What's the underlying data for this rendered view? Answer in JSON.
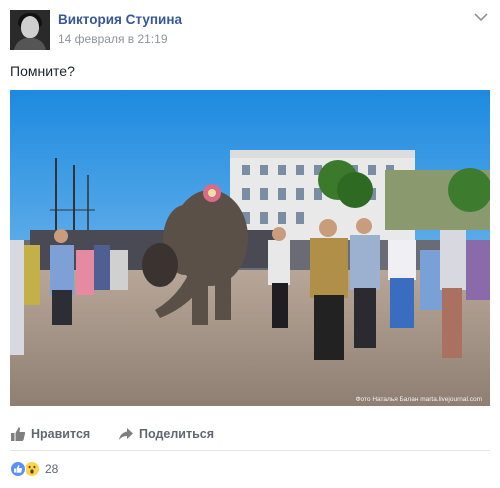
{
  "post": {
    "author": "Виктория Ступина",
    "timestamp": "14 февраля в 21:19",
    "text": "Помните?",
    "photo_credit": "Фото Наталья Балан marta.livejournal.com"
  },
  "actions": {
    "like_label": "Нравится",
    "share_label": "Поделиться"
  },
  "reactions": {
    "types": [
      "like",
      "wow"
    ],
    "count": "28"
  },
  "colors": {
    "author_link": "#365899",
    "meta_text": "#90949c",
    "action_text": "#616770",
    "like_reaction": "#5890ff",
    "wow_reaction": "#fcd34d"
  }
}
